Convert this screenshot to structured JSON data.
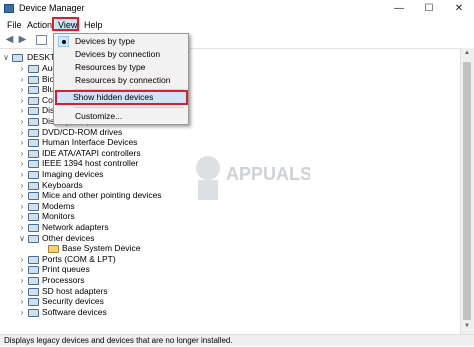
{
  "window": {
    "title": "Device Manager",
    "minimize": "—",
    "maximize": "☐",
    "close": "✕"
  },
  "menu": {
    "items": [
      "File",
      "Action",
      "View",
      "Help"
    ]
  },
  "view_menu": {
    "items": [
      "Devices by type",
      "Devices by connection",
      "Resources by type",
      "Resources by connection",
      "Show hidden devices",
      "Customize..."
    ],
    "selected": "Devices by type"
  },
  "tree": {
    "root": "DESKTO",
    "items": [
      {
        "label": "Aud",
        "expanded": false
      },
      {
        "label": "Bior",
        "expanded": false
      },
      {
        "label": "Blue",
        "expanded": false
      },
      {
        "label": "Com",
        "expanded": false
      },
      {
        "label": "Disk",
        "expanded": false
      },
      {
        "label": "Display adapters",
        "expanded": false
      },
      {
        "label": "DVD/CD-ROM drives",
        "expanded": false
      },
      {
        "label": "Human Interface Devices",
        "expanded": false
      },
      {
        "label": "IDE ATA/ATAPI controllers",
        "expanded": false
      },
      {
        "label": "IEEE 1394 host controller",
        "expanded": false
      },
      {
        "label": "Imaging devices",
        "expanded": false
      },
      {
        "label": "Keyboards",
        "expanded": false
      },
      {
        "label": "Mice and other pointing devices",
        "expanded": false
      },
      {
        "label": "Modems",
        "expanded": false
      },
      {
        "label": "Monitors",
        "expanded": false
      },
      {
        "label": "Network adapters",
        "expanded": false
      },
      {
        "label": "Other devices",
        "expanded": true
      },
      {
        "label": "Base System Device",
        "child": true
      },
      {
        "label": "Ports (COM & LPT)",
        "expanded": false
      },
      {
        "label": "Print queues",
        "expanded": false
      },
      {
        "label": "Processors",
        "expanded": false
      },
      {
        "label": "SD host adapters",
        "expanded": false
      },
      {
        "label": "Security devices",
        "expanded": false
      },
      {
        "label": "Software devices",
        "expanded": false
      }
    ]
  },
  "watermark": {
    "text": "APPUALS"
  },
  "status": {
    "text": "Displays legacy devices and devices that are no longer installed."
  },
  "colors": {
    "highlight_border": "#d6202e",
    "menu_bg": "#f2f2f2",
    "accent": "#3a6ea5"
  }
}
